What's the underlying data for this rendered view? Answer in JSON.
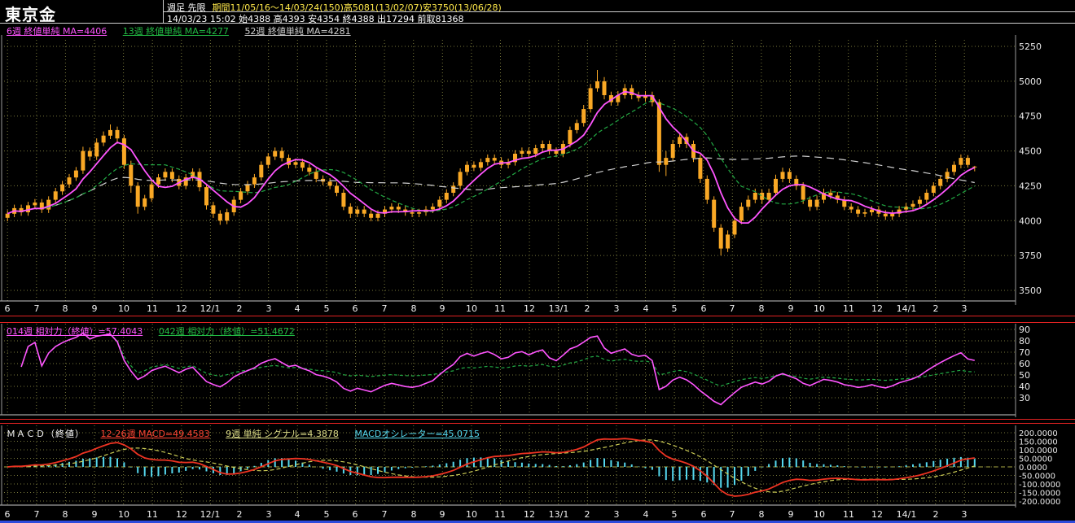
{
  "header": {
    "title": "東京金",
    "line1_left": "週足 先限",
    "line1_right": "期間11/05/16～14/03/24(150)高5081(13/02/07)安3750(13/06/28)",
    "line2": "14/03/23 15:02 始4388 高4393 安4354 終4388 出17294 前取81368"
  },
  "main_chart": {
    "legend": [
      {
        "label": "6週 終値単純 MA=4406",
        "color": "#ff55ff"
      },
      {
        "label": "13週 終値単純 MA=4277",
        "color": "#22bb44"
      },
      {
        "label": "52週 終値単純 MA=4281",
        "color": "#cfcfcf"
      }
    ],
    "y_labels": [
      5250,
      5000,
      4750,
      4500,
      4250,
      4000,
      3750,
      3500
    ]
  },
  "rsi": {
    "legend": [
      {
        "label": "014週 相対力（終値）=57.4043",
        "color": "#ff55ff"
      },
      {
        "label": "042週 相対力（終値）=51.4672",
        "color": "#22bb44"
      }
    ],
    "y_labels": [
      90,
      80,
      70,
      60,
      50,
      40,
      30
    ]
  },
  "macd": {
    "legend_title": "ＭＡＣＤ（終値）",
    "legend": [
      {
        "label": "12-26週 MACD=49.4583",
        "color": "#ff4433"
      },
      {
        "label": "9週 単純 シグナル=4.3878",
        "color": "#dddd88"
      },
      {
        "label": "MACDオシレーター=45.0715",
        "color": "#55d8ee"
      }
    ],
    "y_labels": [
      "200.0000",
      "150.0000",
      "100.0000",
      "50.0000",
      "0.0000",
      "-50.0000",
      "-100.0000",
      "-150.0000",
      "-200.0000"
    ]
  },
  "colors": {
    "candle": "#f9a825",
    "ma6": "#ff55ff",
    "ma13": "#22aa44",
    "ma52": "#cfcfcf",
    "rsi14": "#ff55ff",
    "rsi42": "#22aa44",
    "macd": "#ee3322",
    "signal": "#cccc55",
    "histogram": "#55d8ee",
    "grid": "#77773a",
    "axis_text": "#e8e8e8"
  },
  "chart_data": {
    "type": "candlestick",
    "title": "東京金 週足 先限",
    "x_months": [
      "6",
      "7",
      "8",
      "9",
      "10",
      "11",
      "12",
      "12/1",
      "2",
      "3",
      "4",
      "5",
      "6",
      "7",
      "8",
      "9",
      "10",
      "11",
      "12",
      "13/1",
      "2",
      "3",
      "4",
      "5",
      "6",
      "7",
      "8",
      "9",
      "10",
      "11",
      "12",
      "14/1",
      "2",
      "3"
    ],
    "price_axis": {
      "min": 3500,
      "max": 5250,
      "step": 250
    },
    "period_high": 5081,
    "period_low": 3750,
    "last": {
      "open": 4388,
      "high": 4393,
      "low": 4354,
      "close": 4388,
      "volume": 17294,
      "open_interest": 81368
    },
    "overlays": [
      {
        "name": "MA6",
        "period": 6,
        "value": 4406
      },
      {
        "name": "MA13",
        "period": 13,
        "value": 4277
      },
      {
        "name": "MA52",
        "period": 52,
        "value": 4281
      }
    ],
    "rsi": {
      "periods": [
        14,
        42
      ],
      "values": [
        57.4043,
        51.4672
      ],
      "axis": {
        "min": 30,
        "max": 90,
        "step": 10
      }
    },
    "macd": {
      "fast": 12,
      "slow": 26,
      "signal_period": 9,
      "macd": 49.4583,
      "signal": 4.3878,
      "oscillator": 45.0715,
      "axis": {
        "min": -200,
        "max": 200,
        "step": 50
      }
    },
    "candles_ohlc": [
      [
        4020,
        4075,
        3995,
        4050
      ],
      [
        4050,
        4115,
        4025,
        4090
      ],
      [
        4090,
        4115,
        4035,
        4060
      ],
      [
        4060,
        4135,
        4035,
        4110
      ],
      [
        4110,
        4155,
        4085,
        4130
      ],
      [
        4130,
        4155,
        4055,
        4080
      ],
      [
        4080,
        4175,
        4055,
        4150
      ],
      [
        4150,
        4235,
        4125,
        4210
      ],
      [
        4210,
        4285,
        4185,
        4260
      ],
      [
        4260,
        4335,
        4235,
        4310
      ],
      [
        4310,
        4385,
        4285,
        4360
      ],
      [
        4360,
        4530,
        4335,
        4500
      ],
      [
        4500,
        4525,
        4430,
        4460
      ],
      [
        4460,
        4590,
        4435,
        4560
      ],
      [
        4560,
        4640,
        4535,
        4610
      ],
      [
        4610,
        4690,
        4585,
        4650
      ],
      [
        4650,
        4675,
        4560,
        4590
      ],
      [
        4590,
        4615,
        4370,
        4400
      ],
      [
        4400,
        4430,
        4200,
        4250
      ],
      [
        4250,
        4275,
        4050,
        4100
      ],
      [
        4100,
        4185,
        4075,
        4160
      ],
      [
        4160,
        4285,
        4135,
        4260
      ],
      [
        4260,
        4335,
        4235,
        4310
      ],
      [
        4310,
        4375,
        4285,
        4350
      ],
      [
        4350,
        4375,
        4275,
        4300
      ],
      [
        4300,
        4325,
        4225,
        4250
      ],
      [
        4250,
        4335,
        4225,
        4310
      ],
      [
        4310,
        4375,
        4285,
        4350
      ],
      [
        4350,
        4375,
        4210,
        4240
      ],
      [
        4240,
        4265,
        4080,
        4110
      ],
      [
        4110,
        4135,
        4020,
        4050
      ],
      [
        4050,
        4075,
        3970,
        4000
      ],
      [
        4000,
        4085,
        3975,
        4060
      ],
      [
        4060,
        4175,
        4035,
        4150
      ],
      [
        4150,
        4235,
        4125,
        4210
      ],
      [
        4210,
        4285,
        4185,
        4260
      ],
      [
        4260,
        4335,
        4235,
        4310
      ],
      [
        4310,
        4425,
        4285,
        4400
      ],
      [
        4400,
        4485,
        4375,
        4460
      ],
      [
        4460,
        4525,
        4435,
        4500
      ],
      [
        4500,
        4525,
        4425,
        4450
      ],
      [
        4450,
        4475,
        4375,
        4400
      ],
      [
        4400,
        4445,
        4375,
        4420
      ],
      [
        4420,
        4445,
        4355,
        4380
      ],
      [
        4380,
        4405,
        4325,
        4350
      ],
      [
        4350,
        4375,
        4275,
        4300
      ],
      [
        4300,
        4325,
        4255,
        4280
      ],
      [
        4280,
        4305,
        4225,
        4250
      ],
      [
        4250,
        4275,
        4175,
        4200
      ],
      [
        4200,
        4225,
        4075,
        4100
      ],
      [
        4100,
        4125,
        4020,
        4050
      ],
      [
        4050,
        4105,
        4025,
        4080
      ],
      [
        4080,
        4105,
        4025,
        4050
      ],
      [
        4050,
        4075,
        3995,
        4020
      ],
      [
        4020,
        4075,
        3995,
        4050
      ],
      [
        4050,
        4105,
        4025,
        4080
      ],
      [
        4080,
        4125,
        4055,
        4100
      ],
      [
        4100,
        4125,
        4055,
        4080
      ],
      [
        4080,
        4105,
        4035,
        4060
      ],
      [
        4060,
        4085,
        4025,
        4050
      ],
      [
        4050,
        4085,
        4025,
        4060
      ],
      [
        4060,
        4105,
        4035,
        4080
      ],
      [
        4080,
        4125,
        4055,
        4100
      ],
      [
        4100,
        4175,
        4075,
        4150
      ],
      [
        4150,
        4225,
        4125,
        4200
      ],
      [
        4200,
        4275,
        4175,
        4250
      ],
      [
        4250,
        4375,
        4225,
        4350
      ],
      [
        4350,
        4425,
        4325,
        4400
      ],
      [
        4400,
        4425,
        4355,
        4380
      ],
      [
        4380,
        4445,
        4355,
        4420
      ],
      [
        4420,
        4475,
        4395,
        4450
      ],
      [
        4450,
        4475,
        4405,
        4430
      ],
      [
        4430,
        4455,
        4375,
        4400
      ],
      [
        4400,
        4445,
        4375,
        4420
      ],
      [
        4420,
        4505,
        4395,
        4480
      ],
      [
        4480,
        4525,
        4455,
        4500
      ],
      [
        4500,
        4525,
        4455,
        4480
      ],
      [
        4480,
        4545,
        4455,
        4520
      ],
      [
        4520,
        4575,
        4495,
        4550
      ],
      [
        4550,
        4575,
        4475,
        4500
      ],
      [
        4500,
        4525,
        4455,
        4480
      ],
      [
        4480,
        4575,
        4455,
        4550
      ],
      [
        4550,
        4675,
        4525,
        4650
      ],
      [
        4650,
        4725,
        4625,
        4700
      ],
      [
        4700,
        4830,
        4675,
        4800
      ],
      [
        4800,
        4980,
        4775,
        4950
      ],
      [
        4950,
        5081,
        4925,
        5000
      ],
      [
        5000,
        5030,
        4870,
        4900
      ],
      [
        4900,
        4925,
        4825,
        4850
      ],
      [
        4850,
        4930,
        4825,
        4900
      ],
      [
        4900,
        4980,
        4875,
        4950
      ],
      [
        4950,
        4975,
        4870,
        4900
      ],
      [
        4900,
        4925,
        4855,
        4880
      ],
      [
        4880,
        4930,
        4855,
        4900
      ],
      [
        4900,
        4925,
        4820,
        4850
      ],
      [
        4850,
        4870,
        4350,
        4400
      ],
      [
        4400,
        4500,
        4320,
        4450
      ],
      [
        4450,
        4580,
        4425,
        4550
      ],
      [
        4550,
        4630,
        4525,
        4600
      ],
      [
        4600,
        4625,
        4520,
        4550
      ],
      [
        4550,
        4575,
        4420,
        4450
      ],
      [
        4450,
        4475,
        4270,
        4300
      ],
      [
        4300,
        4325,
        4120,
        4150
      ],
      [
        4150,
        4175,
        3920,
        3950
      ],
      [
        3950,
        3975,
        3750,
        3800
      ],
      [
        3800,
        3930,
        3775,
        3900
      ],
      [
        3900,
        4030,
        3875,
        4000
      ],
      [
        4000,
        4130,
        3975,
        4100
      ],
      [
        4100,
        4180,
        4075,
        4150
      ],
      [
        4150,
        4230,
        4125,
        4200
      ],
      [
        4200,
        4225,
        4120,
        4150
      ],
      [
        4150,
        4230,
        4125,
        4200
      ],
      [
        4200,
        4330,
        4175,
        4300
      ],
      [
        4300,
        4380,
        4275,
        4350
      ],
      [
        4350,
        4375,
        4270,
        4300
      ],
      [
        4300,
        4325,
        4220,
        4250
      ],
      [
        4250,
        4275,
        4120,
        4150
      ],
      [
        4150,
        4175,
        4070,
        4100
      ],
      [
        4100,
        4180,
        4075,
        4150
      ],
      [
        4150,
        4230,
        4125,
        4200
      ],
      [
        4200,
        4225,
        4155,
        4180
      ],
      [
        4180,
        4205,
        4125,
        4150
      ],
      [
        4150,
        4175,
        4075,
        4100
      ],
      [
        4100,
        4125,
        4055,
        4080
      ],
      [
        4080,
        4105,
        4025,
        4050
      ],
      [
        4050,
        4085,
        4025,
        4060
      ],
      [
        4060,
        4105,
        4035,
        4080
      ],
      [
        4080,
        4105,
        4025,
        4050
      ],
      [
        4050,
        4075,
        4005,
        4030
      ],
      [
        4030,
        4075,
        4005,
        4050
      ],
      [
        4050,
        4105,
        4025,
        4080
      ],
      [
        4080,
        4125,
        4055,
        4100
      ],
      [
        4100,
        4145,
        4075,
        4120
      ],
      [
        4120,
        4175,
        4095,
        4150
      ],
      [
        4150,
        4225,
        4125,
        4200
      ],
      [
        4200,
        4275,
        4175,
        4250
      ],
      [
        4250,
        4325,
        4225,
        4300
      ],
      [
        4300,
        4375,
        4275,
        4350
      ],
      [
        4350,
        4425,
        4325,
        4400
      ],
      [
        4400,
        4475,
        4375,
        4450
      ],
      [
        4450,
        4470,
        4380,
        4400
      ],
      [
        4388,
        4393,
        4354,
        4388
      ]
    ]
  }
}
